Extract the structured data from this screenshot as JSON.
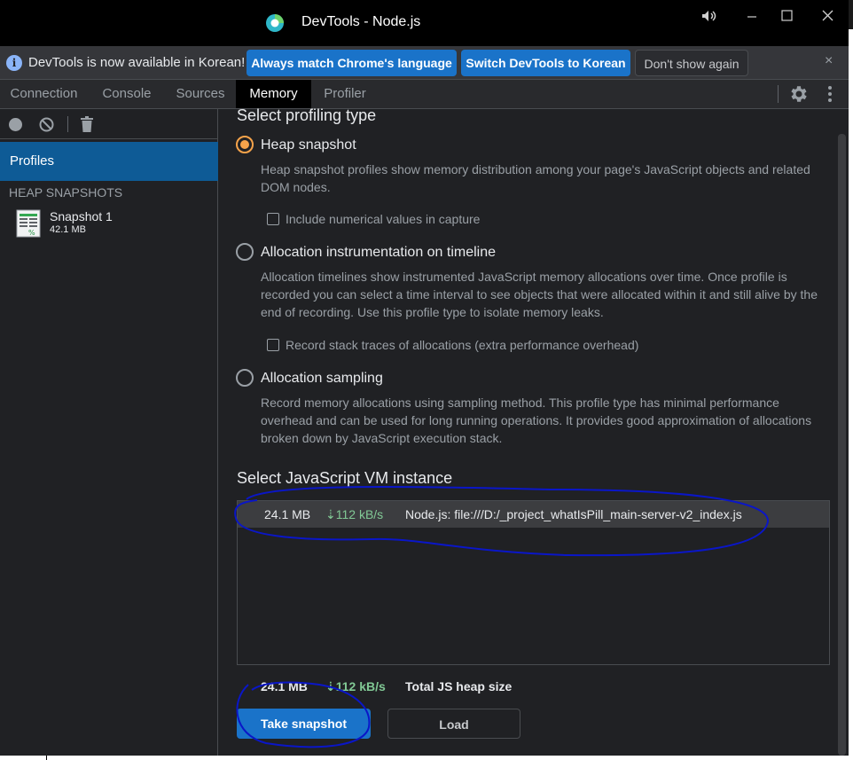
{
  "window": {
    "title": "DevTools - Node.js",
    "controls": [
      "volume-icon",
      "minimize-icon",
      "maximize-icon",
      "close-icon"
    ]
  },
  "infobar": {
    "message": "DevTools is now available in Korean!",
    "buttons": {
      "match": "Always match Chrome's language",
      "switch": "Switch DevTools to Korean",
      "dismiss": "Don't show again"
    },
    "close_symbol": "×"
  },
  "tabs": [
    {
      "label": "Connection",
      "active": false
    },
    {
      "label": "Console",
      "active": false
    },
    {
      "label": "Sources",
      "active": false
    },
    {
      "label": "Memory",
      "active": true
    },
    {
      "label": "Profiler",
      "active": false
    }
  ],
  "sidebar": {
    "profiles_label": "Profiles",
    "group_label": "HEAP SNAPSHOTS",
    "snapshots": [
      {
        "name": "Snapshot 1",
        "size": "42.1 MB"
      }
    ]
  },
  "main": {
    "profiling_title": "Select profiling type",
    "options": [
      {
        "title": "Heap snapshot",
        "selected": true,
        "description": "Heap snapshot profiles show memory distribution among your page's JavaScript objects and related DOM nodes.",
        "checkbox_label": "Include numerical values in capture",
        "checkbox_checked": false
      },
      {
        "title": "Allocation instrumentation on timeline",
        "selected": false,
        "description": "Allocation timelines show instrumented JavaScript memory allocations over time. Once profile is recorded you can select a time interval to see objects that were allocated within it and still alive by the end of recording. Use this profile type to isolate memory leaks.",
        "checkbox_label": "Record stack traces of allocations (extra performance overhead)",
        "checkbox_checked": false
      },
      {
        "title": "Allocation sampling",
        "selected": false,
        "description": "Record memory allocations using sampling method. This profile type has minimal performance overhead and can be used for long running operations. It provides good approximation of allocations broken down by JavaScript execution stack."
      }
    ],
    "vm_title": "Select JavaScript VM instance",
    "vm_instances": [
      {
        "size": "24.1 MB",
        "rate": "⇣112 kB/s",
        "name": "Node.js: file:///D:/_project_whatIsPill_main-server-v2_index.js"
      }
    ],
    "total": {
      "size": "24.1 MB",
      "rate": "⇣112 kB/s",
      "label": "Total JS heap size"
    },
    "take_snapshot": "Take snapshot",
    "load": "Load"
  },
  "colors": {
    "accent": "#1a73c9",
    "selected_nav": "#0e5b96",
    "radio_selected": "#f6a34a",
    "rate_green": "#81c995",
    "annotation_ink": "#0a16c8"
  }
}
